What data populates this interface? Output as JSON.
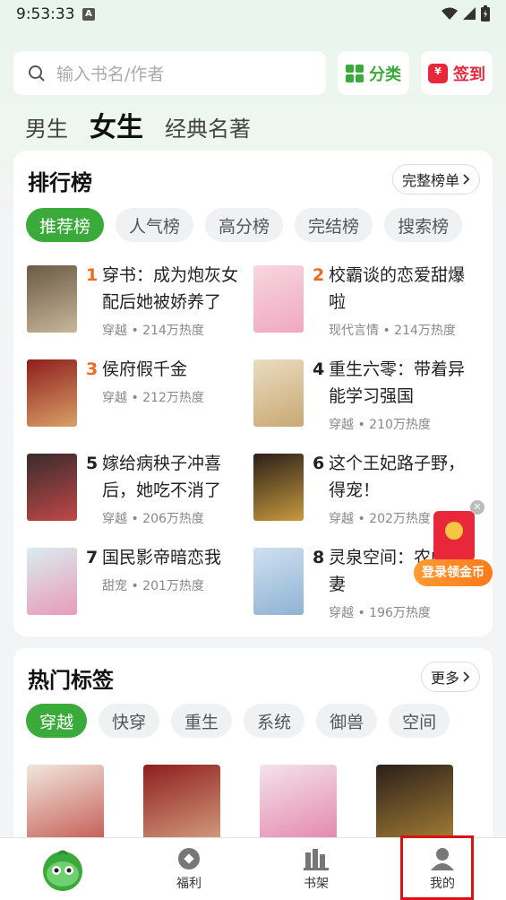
{
  "status_bar": {
    "time": "9:53:33",
    "indicator": "A"
  },
  "search": {
    "placeholder": "输入书名/作者"
  },
  "top_buttons": {
    "category": "分类",
    "signin": "签到"
  },
  "gender_tabs": [
    {
      "label": "男生",
      "active": false
    },
    {
      "label": "女生",
      "active": true
    },
    {
      "label": "经典名著",
      "active": false
    }
  ],
  "ranking": {
    "title": "排行榜",
    "more": "完整榜单",
    "tabs": [
      "推荐榜",
      "人气榜",
      "高分榜",
      "完结榜",
      "搜索榜"
    ],
    "books": [
      {
        "rank": "1",
        "title": "穿书：成为炮灰女配后她被娇养了",
        "meta": "穿越 • 214万热度",
        "cover_colors": [
          "#6b5a45",
          "#c8b79a"
        ]
      },
      {
        "rank": "2",
        "title": "校霸谈的恋爱甜爆啦",
        "meta": "现代言情 • 214万热度",
        "cover_colors": [
          "#f7d6e0",
          "#f0a8c0"
        ]
      },
      {
        "rank": "3",
        "title": "侯府假千金",
        "meta": "穿越 • 212万热度",
        "cover_colors": [
          "#8e1e1e",
          "#d9a066"
        ]
      },
      {
        "rank": "4",
        "title": "重生六零：带着异能学习强国",
        "meta": "穿越 • 210万热度",
        "cover_colors": [
          "#e9dcc0",
          "#c9a873"
        ]
      },
      {
        "rank": "5",
        "title": "嫁给病秧子冲喜后，她吃不消了",
        "meta": "穿越 • 206万热度",
        "cover_colors": [
          "#3a2b2b",
          "#c04848"
        ]
      },
      {
        "rank": "6",
        "title": "这个王妃路子野，得宠！",
        "meta": "穿越 • 202万热度",
        "cover_colors": [
          "#2b1f1a",
          "#c79a3e"
        ]
      },
      {
        "rank": "7",
        "title": "国民影帝暗恋我",
        "meta": "甜宠 • 201万热度",
        "cover_colors": [
          "#d9ecf0",
          "#e89bb8"
        ]
      },
      {
        "rank": "8",
        "title": "灵泉空间：农门运妻",
        "meta": "穿越 • 196万热度",
        "cover_colors": [
          "#cfe0ef",
          "#8fb3d4"
        ]
      }
    ]
  },
  "hot_tags": {
    "title": "热门标签",
    "more": "更多",
    "tags": [
      "穿越",
      "快穿",
      "重生",
      "系统",
      "御兽",
      "空间"
    ],
    "cover_colors": [
      [
        "#f1e7de",
        "#b8342c"
      ],
      [
        "#8e1e1e",
        "#e8c29a"
      ],
      [
        "#f3e3ea",
        "#e06a9a"
      ],
      [
        "#2b1f1a",
        "#c79a3e"
      ]
    ]
  },
  "float_banner": {
    "label": "登录领金币"
  },
  "bottom_nav": [
    {
      "label": "",
      "icon": "mascot-icon"
    },
    {
      "label": "福利",
      "icon": "welfare-icon"
    },
    {
      "label": "书架",
      "icon": "bookshelf-icon"
    },
    {
      "label": "我的",
      "icon": "profile-icon"
    }
  ],
  "colors": {
    "accent": "#3aaa3a",
    "rank_highlight": "#f06a1d",
    "signin": "#e8283a"
  }
}
